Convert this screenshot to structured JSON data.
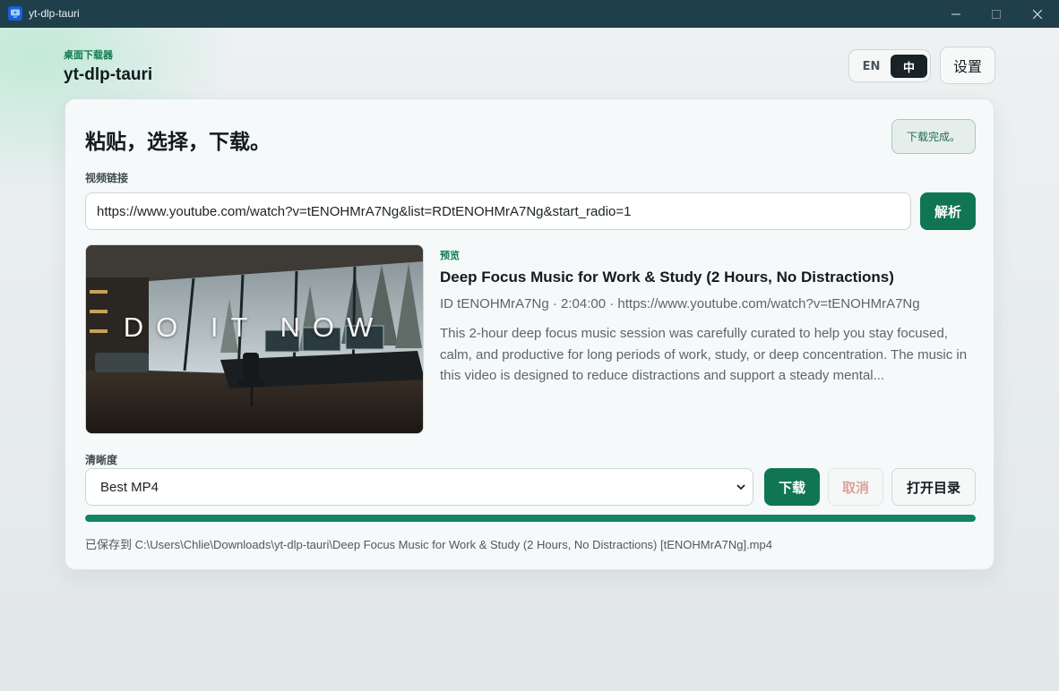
{
  "window": {
    "title": "yt-dlp-tauri",
    "controls": {
      "minimize_icon": "minimize-icon",
      "maximize_icon": "maximize-icon",
      "close_icon": "close-icon"
    }
  },
  "header": {
    "eyebrow": "桌面下载器",
    "title": "yt-dlp-tauri",
    "lang": {
      "en": "EN",
      "zh": "中",
      "selected": "中"
    },
    "settings_label": "设置"
  },
  "main": {
    "heading": "粘贴，选择，下载。",
    "status": "下载完成。",
    "url_label": "视频链接",
    "url_value": "https://www.youtube.com/watch?v=tENOHMrA7Ng&list=RDtENOHMrA7Ng&start_radio=1",
    "parse_label": "解析",
    "preview": {
      "label": "预览",
      "thumbnail_text": "DO IT NOW",
      "title": "Deep Focus Music for Work & Study (2 Hours, No Distractions)",
      "meta": "ID tENOHMrA7Ng · 2:04:00 · https://www.youtube.com/watch?v=tENOHMrA7Ng",
      "description": "This 2-hour deep focus music session was carefully curated to help you stay focused, calm, and productive for long periods of work, study, or deep concentration. The music in this video is designed to reduce distractions and support a steady mental..."
    },
    "quality_label": "清晰度",
    "quality_value": "Best MP4",
    "download_label": "下载",
    "cancel_label": "取消",
    "open_dir_label": "打开目录",
    "progress_percent": 100,
    "saved_path": "已保存到 C:\\Users\\Chlie\\Downloads\\yt-dlp-tauri\\Deep Focus Music for Work & Study (2 Hours, No Distractions) [tENOHMrA7Ng].mp4"
  },
  "colors": {
    "accent": "#107553",
    "titlebar": "#1f3f4a",
    "progress": "#128560",
    "cancel_text": "#dca29b"
  }
}
